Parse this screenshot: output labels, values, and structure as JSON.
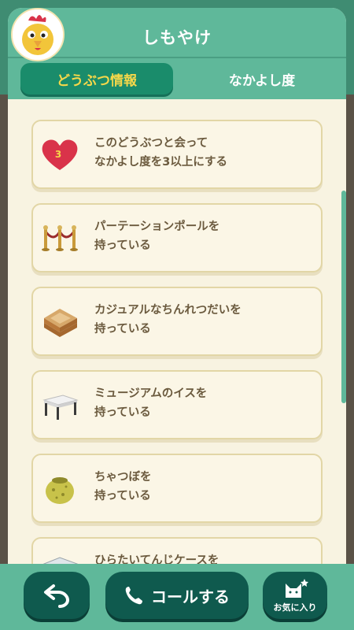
{
  "header": {
    "title": "しもやけ"
  },
  "tabs": [
    {
      "label": "どうぶつ情報",
      "active": true
    },
    {
      "label": "なかよし度",
      "active": false
    }
  ],
  "heart_badge": "3",
  "items": [
    {
      "line1": "このどうぶつと会って",
      "line2": "なかよし度を3以上にする",
      "icon": "heart-icon"
    },
    {
      "line1": "パーテーションポールを",
      "line2": "持っている",
      "icon": "partition-pole-icon"
    },
    {
      "line1": "カジュアルなちんれつだいを",
      "line2": "持っている",
      "icon": "display-stand-icon"
    },
    {
      "line1": "ミュージアムのイスを",
      "line2": "持っている",
      "icon": "museum-chair-icon"
    },
    {
      "line1": "ちゃつぼを",
      "line2": "持っている",
      "icon": "tea-jar-icon"
    },
    {
      "line1": "ひらたいてんじケースを",
      "line2": "",
      "icon": "display-case-icon"
    }
  ],
  "footer": {
    "call_label": "コールする",
    "fav_label": "お気に入り"
  },
  "colors": {
    "header": "#5fb89a",
    "tab_active": "#1a8c6b",
    "tab_active_text": "#f6d84a",
    "card_bg": "#fbf6e6",
    "text": "#6b5a3e",
    "button": "#0f5a4e"
  }
}
